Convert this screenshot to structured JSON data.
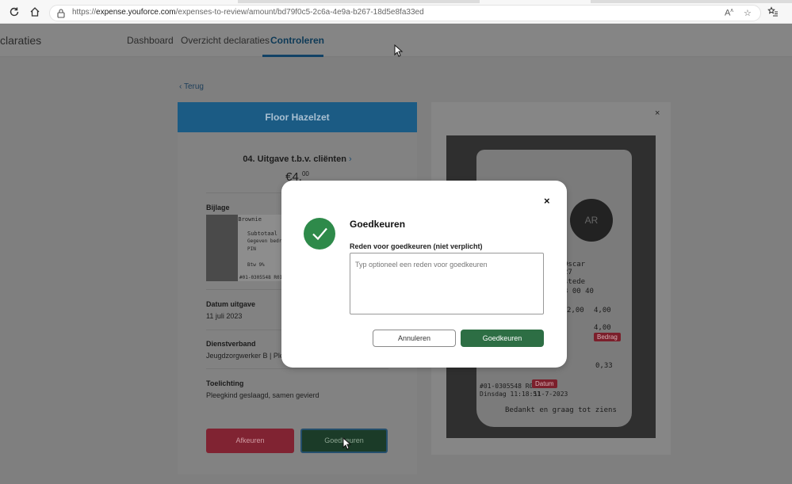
{
  "browser": {
    "url_prefix": "https://",
    "url_host": "expense.youforce.com",
    "url_path": "/expenses-to-review/amount/bd79f0c5-2c6a-4e9a-b267-18d5e8fa33ed",
    "icons": [
      "refresh-icon",
      "home-icon",
      "lock-icon",
      "read-aloud-icon",
      "favorite-star-icon",
      "favorites-list-icon"
    ]
  },
  "app": {
    "brand": "claraties",
    "nav": [
      "Dashboard",
      "Overzicht declaraties",
      "Controleren"
    ],
    "active_nav": "Controleren"
  },
  "back_label": "Terug",
  "expense": {
    "employee": "Floor Hazelzet",
    "category": "04. Uitgave t.b.v. cliënten",
    "amount_main": "€4,",
    "amount_cents": "00",
    "attachment_label": "Bijlage",
    "date_label": "Datum uitgave",
    "date_value": "11 juli 2023",
    "employment_label": "Dienstverband",
    "employment_value": "Jeugdzorgwerker B | Ple",
    "notes_label": "Toelichting",
    "notes_value": "Pleegkind geslaagd, samen gevierd",
    "reject_label": "Afkeuren",
    "approve_label": "Goedkeuren"
  },
  "receipt": {
    "lines": [
      "Oscar",
      "27",
      "stede",
      "3 00 40",
      "2,00",
      "4,00",
      "4,00",
      "0,33",
      "#01-0305548 R01 HE",
      "Dinsdag 11:18:51",
      "11-7-2023",
      "Bedankt en graag tot ziens"
    ],
    "logo_text": "AR",
    "thumb_lines": [
      "2 Brownie",
      "Subtotaal",
      "Gegeven bedrag",
      "PIN",
      "Btw 9%",
      "#01-0305548 R01 HE"
    ],
    "tag_amount": "Bedrag",
    "tag_date": "Datum",
    "colors": {
      "tag": "#7b1f2b"
    }
  },
  "modal": {
    "title": "Goedkeuren",
    "field_label": "Reden voor goedkeuren (niet verplicht)",
    "placeholder": "Typ optioneel een reden voor goedkeuren",
    "cancel_label": "Annuleren",
    "approve_label": "Goedkeuren",
    "colors": {
      "accent": "#2d6e44",
      "check_circle": "#2e8a4a"
    }
  }
}
